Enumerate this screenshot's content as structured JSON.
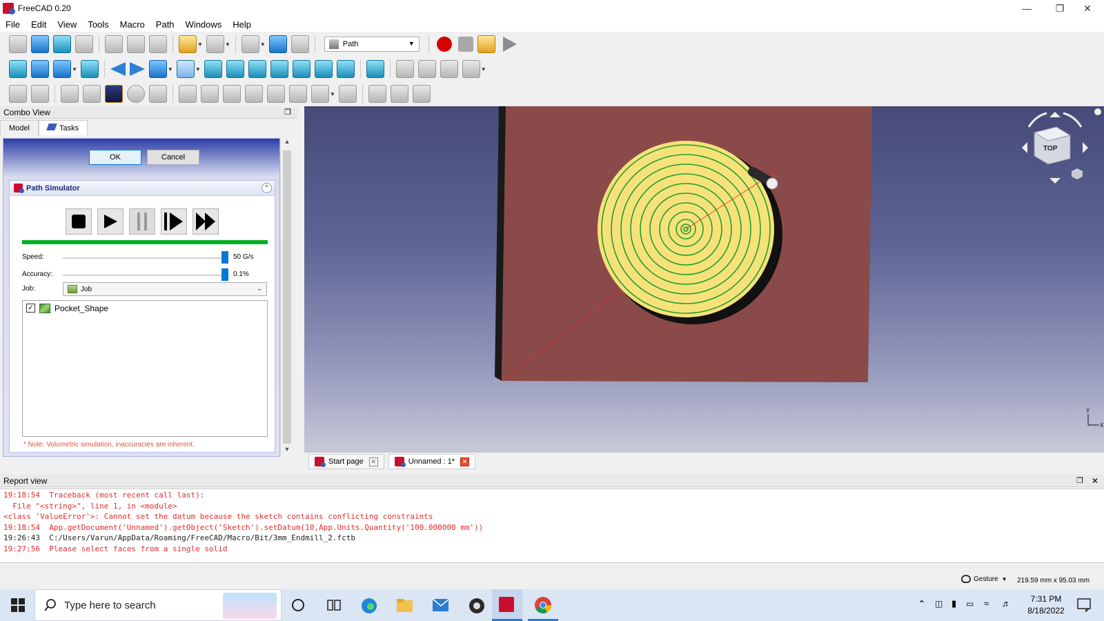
{
  "window": {
    "title": "FreeCAD 0.20"
  },
  "menu": [
    "File",
    "Edit",
    "View",
    "Tools",
    "Macro",
    "Path",
    "Windows",
    "Help"
  ],
  "toolbar": {
    "workbench": "Path"
  },
  "combo_view": {
    "title": "Combo View",
    "tabs": [
      "Model",
      "Tasks"
    ],
    "ok_label": "OK",
    "cancel_label": "Cancel",
    "simulator": {
      "title": "Path Simulator",
      "speed_label": "Speed:",
      "speed_value": "50 G/s",
      "speed_level": 1.0,
      "accuracy_label": "Accuracy:",
      "accuracy_value": "0.1%",
      "accuracy_level": 1.0,
      "progress": 1.0,
      "job_label": "Job:",
      "job_value": "Job",
      "operations": [
        {
          "label": "Pocket_Shape",
          "checked": true
        }
      ],
      "note": "* Note: Volumetric simulation, inaccuracies are inherent."
    }
  },
  "view_tabs": [
    {
      "label": "Start page",
      "active": false
    },
    {
      "label": "Unnamed : 1*",
      "active": true
    }
  ],
  "navcube": {
    "face": "TOP"
  },
  "axis": {
    "y": "Y",
    "x": "X"
  },
  "report_view": {
    "title": "Report view",
    "lines": [
      {
        "text": "19:18:54  Traceback (most recent call last):",
        "type": "err"
      },
      {
        "text": "  File \"<string>\", line 1, in <module>",
        "type": "err"
      },
      {
        "text": "<class 'ValueError'>: Cannot set the datum because the sketch contains conflicting constraints",
        "type": "err"
      },
      {
        "text": "19:18:54  App.getDocument('Unnamed').getObject('Sketch').setDatum(10,App.Units.Quantity('100.000000 mm'))",
        "type": "err"
      },
      {
        "text": "19:26:43  C:/Users/Varun/AppData/Roaming/FreeCAD/Macro/Bit/3mm_Endmill_2.fctb",
        "type": "log"
      },
      {
        "text": "19:27:56  Please select faces from a single solid",
        "type": "err"
      }
    ]
  },
  "statusbar": {
    "navigation_style": "Gesture",
    "dimensions": "219.59 mm x 95.03 mm"
  },
  "taskbar": {
    "search_placeholder": "Type here to search",
    "time": "7:31 PM",
    "date": "8/18/2022"
  },
  "colors": {
    "stock": "#8b4a4a",
    "part": "#f7e27a",
    "toolpath": "#1e9e2e",
    "progress": "#06b025",
    "accent": "#0078d7"
  }
}
